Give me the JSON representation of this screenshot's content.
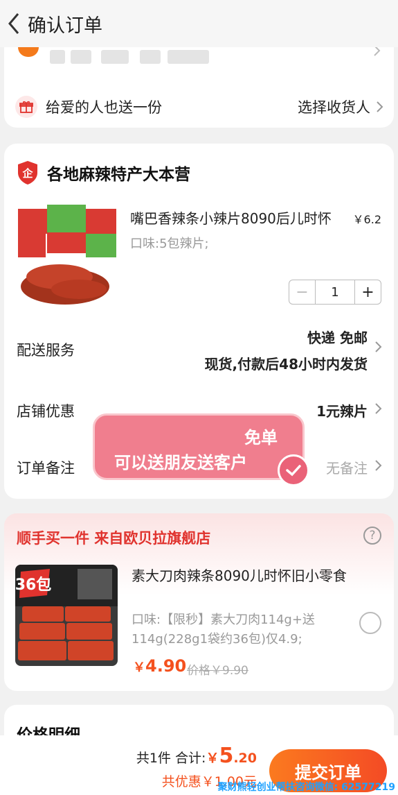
{
  "header": {
    "title": "确认订单",
    "back_icon": "back-arrow-icon"
  },
  "address": {
    "gift_label": "给爱的人也送一份",
    "gift_action": "选择收货人",
    "accent": "#f47a1b"
  },
  "shop": {
    "name": "各地麻辣特产大本营",
    "product": {
      "title": "嘴巴香辣条小辣片8090后儿时怀",
      "price": "￥6.2",
      "spec": "口味:5包辣片;",
      "quantity": "1"
    },
    "delivery": {
      "label": "配送服务",
      "method": "快递 免邮",
      "note": "现货,付款后48小时内发货"
    },
    "discount": {
      "label": "店铺优惠",
      "value": "1元辣片"
    },
    "remark": {
      "label": "订单备注",
      "value": "无备注"
    },
    "popup": {
      "line1": "免单",
      "line2": "可以送朋友送客户"
    }
  },
  "addon": {
    "title": "顺手买一件  来自欧贝拉旗舰店",
    "name": "素大刀肉辣条8090儿时怀旧小零食",
    "spec": "口味:【限秒】素大刀肉114g+送114g(228g1袋约36包)仅4.9;",
    "price_currency": "￥",
    "price": "4.90",
    "original_price": "价格￥9.90",
    "image_badge": "36包"
  },
  "details": {
    "title": "价格明细"
  },
  "bottom": {
    "count": "共1件",
    "total_label": "合计:",
    "total_currency": "￥",
    "total_int": "5",
    "total_dec": ".20",
    "discount": "共优惠￥1.00元",
    "submit": "提交订单"
  },
  "watermark": "聚财熊轻创业帮扶咨询微信: 62577219",
  "colors": {
    "accent_red": "#e0332e",
    "price_orange": "#f4511e",
    "button_start": "#fb7a1f",
    "button_end": "#f44b25"
  }
}
